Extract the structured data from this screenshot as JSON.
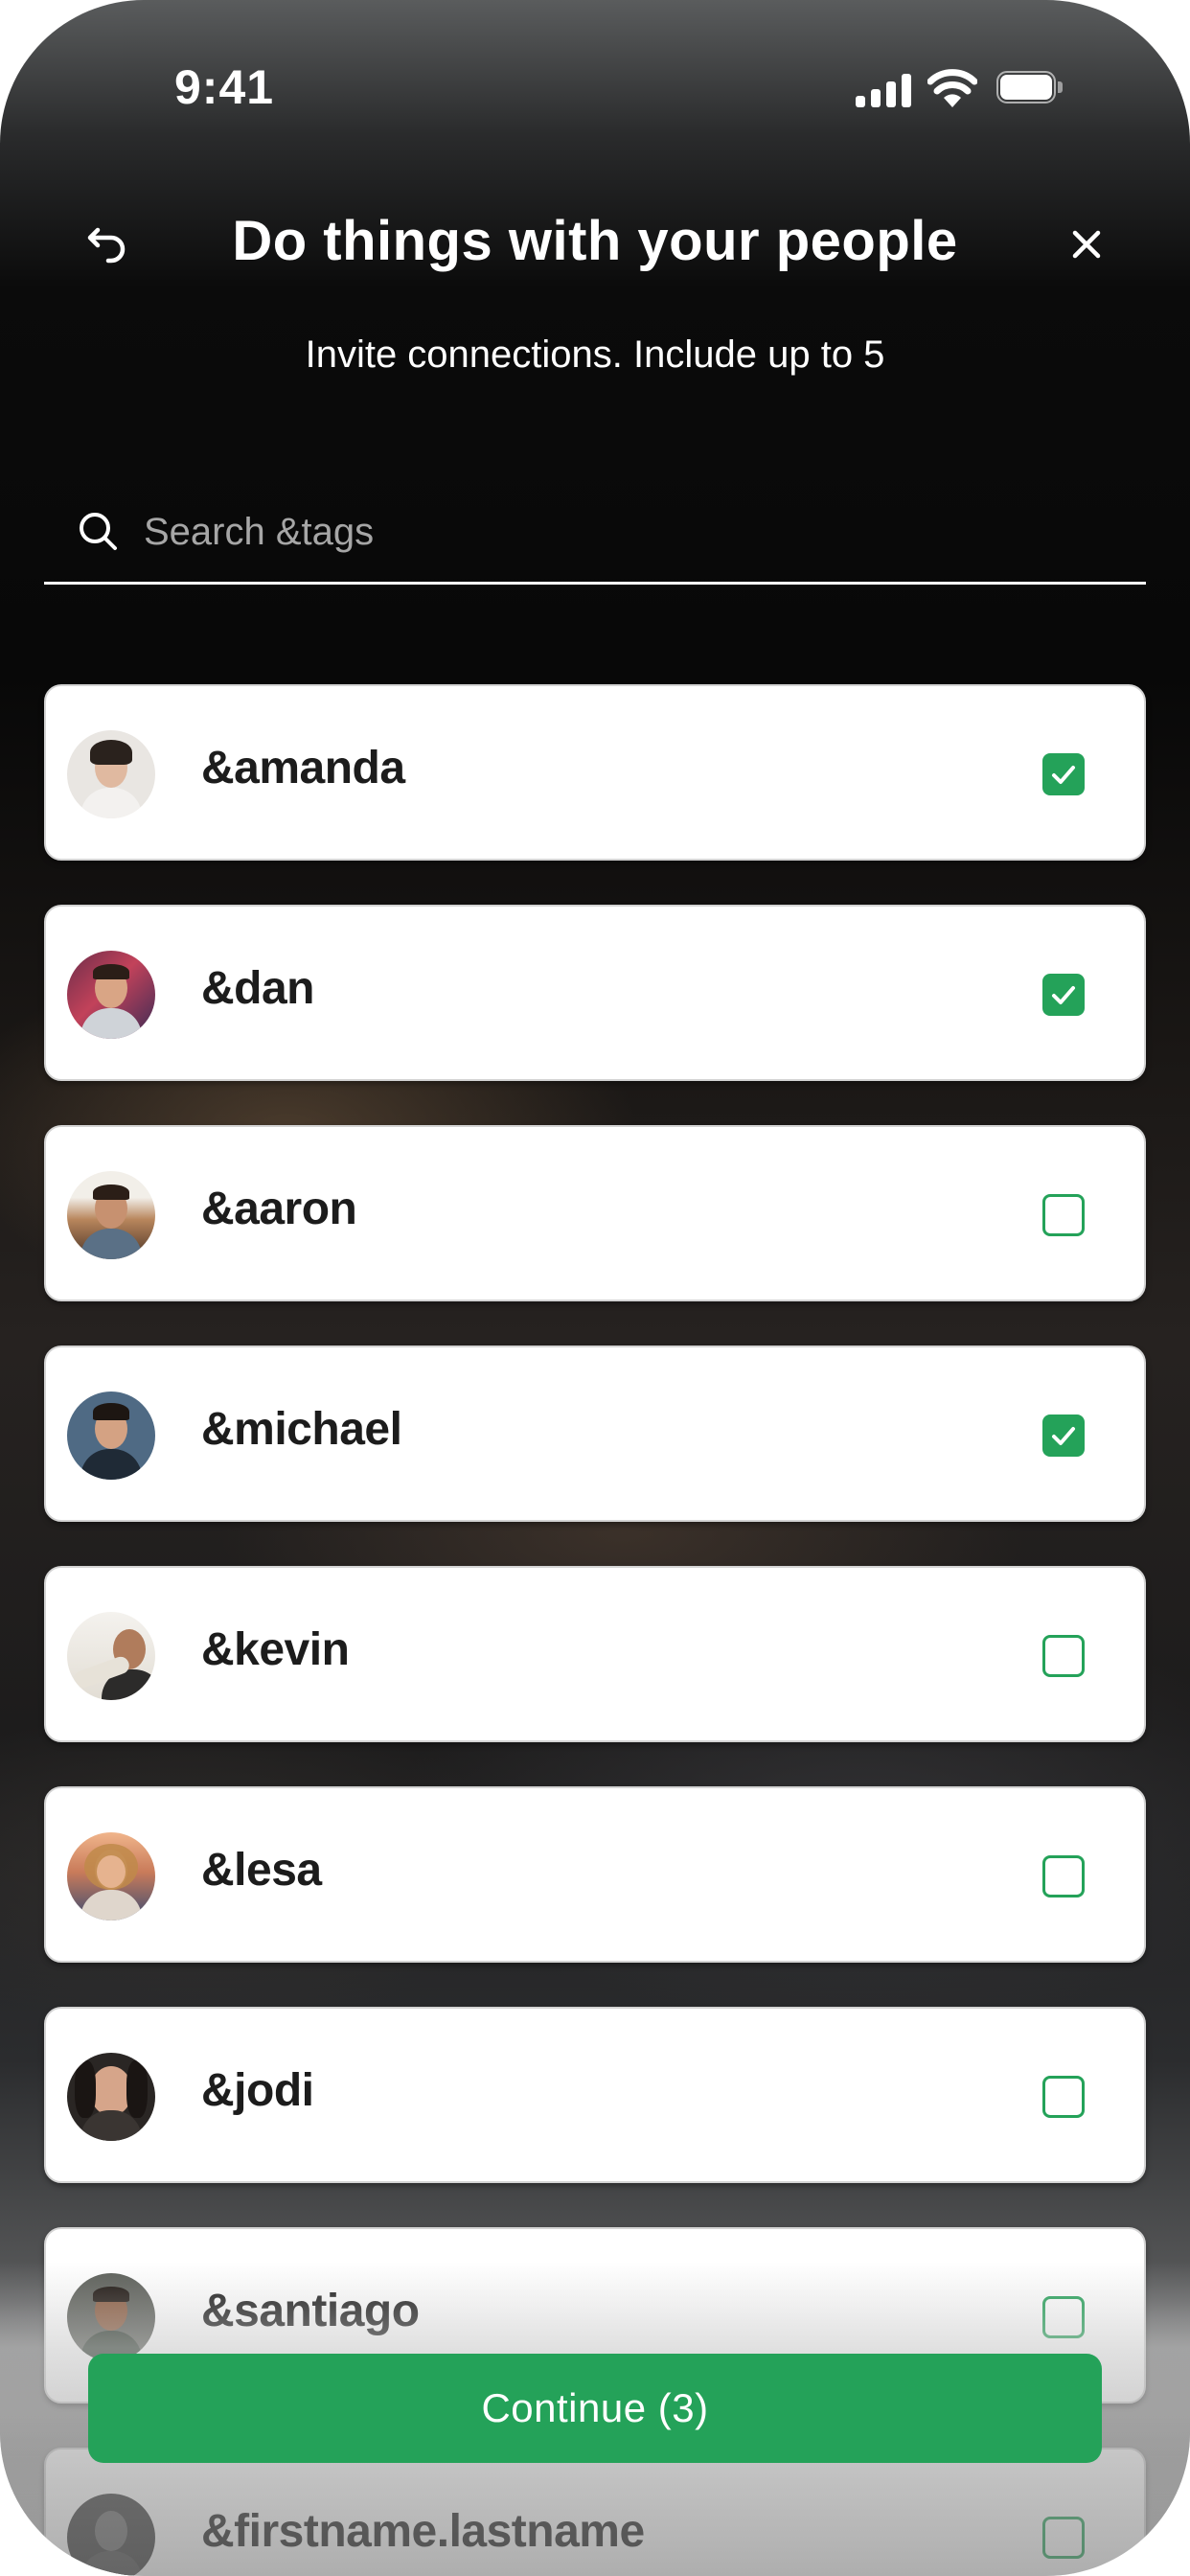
{
  "status_bar": {
    "time": "9:41"
  },
  "header": {
    "title": "Do things with your people",
    "subtitle": "Invite connections. Include up to 5"
  },
  "search": {
    "placeholder": "Search &tags",
    "value": ""
  },
  "colors": {
    "accent": "#24a259",
    "card": "#ffffff",
    "text": "#1c1c1c"
  },
  "connections": [
    {
      "handle": "&amanda",
      "checked": true
    },
    {
      "handle": "&dan",
      "checked": true
    },
    {
      "handle": "&aaron",
      "checked": false
    },
    {
      "handle": "&michael",
      "checked": true
    },
    {
      "handle": "&kevin",
      "checked": false
    },
    {
      "handle": "&lesa",
      "checked": false
    },
    {
      "handle": "&jodi",
      "checked": false
    },
    {
      "handle": "&santiago",
      "checked": false
    },
    {
      "handle": "&firstname.lastname",
      "checked": false
    }
  ],
  "footer": {
    "continue_label": "Continue (3)"
  }
}
